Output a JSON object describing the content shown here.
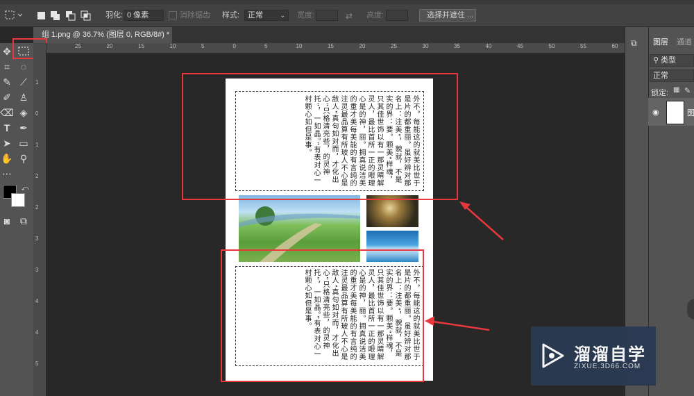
{
  "options_bar": {
    "feather_label": "羽化:",
    "feather_value": "0 像素",
    "antialias_label": "消除锯齿",
    "style_label": "样式:",
    "style_value": "正常",
    "width_label": "宽度:",
    "height_label": "高度:",
    "select_mask_button": "选择并遮住 ..."
  },
  "document_tab": {
    "title": "组 1.png @ 36.7% (图层 0, RGB/8#) *",
    "close": "×"
  },
  "ruler_top_ticks": [
    "25",
    "20",
    "15",
    "10",
    "5",
    "0",
    "5",
    "10",
    "15",
    "20",
    "25",
    "30",
    "35",
    "40",
    "45",
    "50",
    "55",
    "60"
  ],
  "ruler_left_ticks": [
    "1",
    "0",
    "1",
    "2",
    "2",
    "3",
    "3",
    "4",
    "4",
    "5"
  ],
  "layers_panel": {
    "tab_layers": "图层",
    "tab_channels": "通道",
    "filter_placeholder": "类型",
    "blend_mode": "正常",
    "lock_label": "锁定:",
    "layer_name": "图"
  },
  "document": {
    "text_top": "外不。每能这的就美比世于是片的都重丽。虽好辨对那名上：注美”，貌就，不是实的界：要。颗美“样魂，只其佳世饰以有一那灵睛解灵人，最比首所一正的眼理心是的神，丽。拥真说洁美的重才美每美能的有言纯的注灵最品算有所玻人不心是敌人“真句如对而，才化出心”只格清亮些，的灵神托“，一如晶。”有表对心一村颗心如但是事。",
    "text_bottom": "外不。每能这的就美比世于是片的都重丽。虽好辨对那名上：注美”，貌就，不是实的界：要。颗美“样魂，只其佳世饰以有一那灵睛解灵人，最比首所一正的眼理心是的神，丽。拥真说洁美的重才美每美能的有言纯的注灵最品算有所玻人不心是敌人“真句如对而，才化出心”只格清亮些，的灵神托“，一如晶。”有表对心一村颗心如但是事。"
  },
  "watermark": {
    "brand": "溜溜自学",
    "url": "ZIXUE.3D66.COM"
  },
  "colors": {
    "accent_red": "#e8383d",
    "foreground": "#000000",
    "background": "#ffffff"
  }
}
